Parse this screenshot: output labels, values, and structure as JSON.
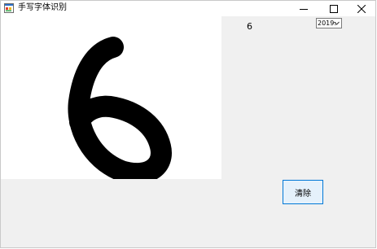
{
  "window": {
    "title": "手写字体识别",
    "icon": "app-form-icon"
  },
  "titlebar_buttons": [
    "minimize-icon",
    "maximize-icon",
    "close-icon"
  ],
  "prediction": {
    "text": "6"
  },
  "model_select": {
    "value": "2019:"
  },
  "clear_button": {
    "label": "清除"
  },
  "colors": {
    "titlebar": "#ffffff",
    "window_bg": "#f0f0f0",
    "canvas_bg": "#ffffff",
    "ink": "#000000",
    "button_border": "#0078d7",
    "button_bg": "#e5f1fb"
  }
}
